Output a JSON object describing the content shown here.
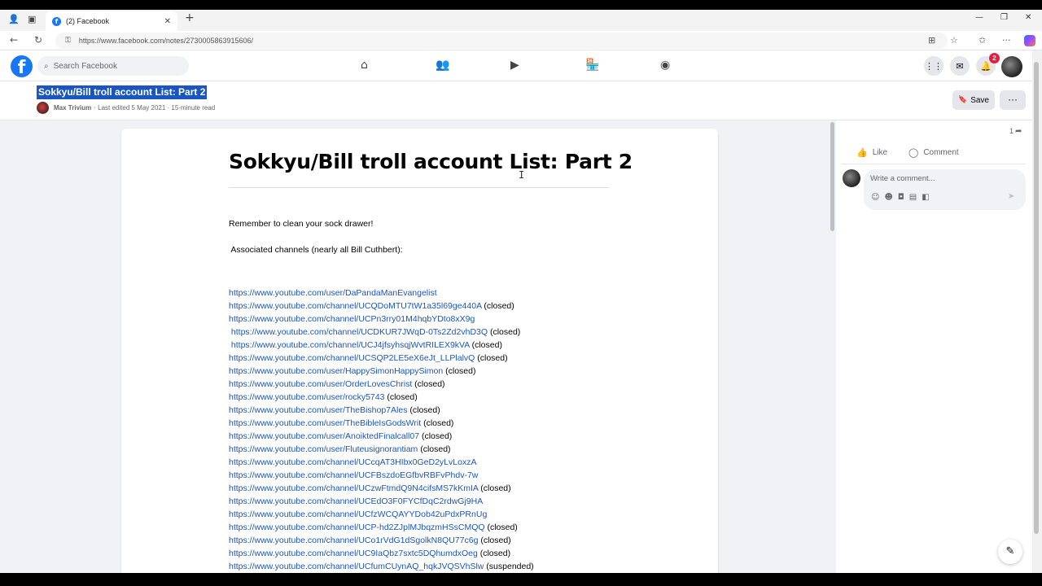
{
  "browser": {
    "tab_title": "(2) Facebook",
    "tab_close": "✕",
    "new_tab": "+",
    "url": "https://www.facebook.com/notes/2730005863915606/"
  },
  "fb": {
    "search_placeholder": "Search Facebook",
    "notification_count": "2"
  },
  "note": {
    "title": "Sokkyu/Bill troll account List: Part 2",
    "author": "Max Trivium",
    "meta": "· Last edited 5 May 2021 · 15-minute read",
    "save_label": "Save",
    "more_label": "···",
    "heading": "Sokkyu/Bill troll account List: Part 2",
    "para1": "Remember to clean your sock drawer!",
    "para2": " Associated channels (nearly all Bill Cuthbert):",
    "links": [
      {
        "url": "https://www.youtube.com/user/DaPandaManEvangelist",
        "status": ""
      },
      {
        "url": "https://www.youtube.com/channel/UCQDoMTU7tW1a35l69ge440A",
        "status": " (closed)"
      },
      {
        "url": "https://www.youtube.com/channel/UCPn3rry01M4hqbYDto8xX9g",
        "status": ""
      },
      {
        "url": " https://www.youtube.com/channel/UCDKUR7JWqD-0Ts2Zd2vhD3Q",
        "status": " (closed)"
      },
      {
        "url": " https://www.youtube.com/channel/UCJ4jfsyhsqjWvtRILEX9kVA",
        "status": " (closed)"
      },
      {
        "url": "https://www.youtube.com/channel/UCSQP2LE5eX6eJt_LLPlalvQ",
        "status": " (closed)"
      },
      {
        "url": "https://www.youtube.com/user/HappySimonHappySimon",
        "status": " (closed)"
      },
      {
        "url": "https://www.youtube.com/user/OrderLovesChrist",
        "status": " (closed)"
      },
      {
        "url": "https://www.youtube.com/user/rocky5743",
        "status": " (closed)"
      },
      {
        "url": "https://www.youtube.com/user/TheBishop7Ales",
        "status": " (closed)"
      },
      {
        "url": "https://www.youtube.com/user/TheBibleIsGodsWrit",
        "status": " (closed)"
      },
      {
        "url": "https://www.youtube.com/user/AnoiktedFinalcall07",
        "status": " (closed)"
      },
      {
        "url": "https://www.youtube.com/user/Fluteusignorantiam",
        "status": " (closed)"
      },
      {
        "url": "https://www.youtube.com/channel/UCcqAT3HIbx0GeD2yLvLoxzA",
        "status": ""
      },
      {
        "url": "https://www.youtube.com/channel/UCFBszdoEGfbvRBFvPhdv-7w",
        "status": ""
      },
      {
        "url": "https://www.youtube.com/channel/UCzwFtmdQ9N4cifsMS7kKmIA",
        "status": " (closed)"
      },
      {
        "url": "https://www.youtube.com/channel/UCEdO3F0FYCfDqC2rdwGj9HA",
        "status": ""
      },
      {
        "url": "https://www.youtube.com/channel/UCfzWCQAYYDob42uPdxPRnUg",
        "status": ""
      },
      {
        "url": "https://www.youtube.com/channel/UCP-hd2ZJplMJbqzmHSsCMQQ",
        "status": " (closed)"
      },
      {
        "url": "https://www.youtube.com/channel/UCo1rVdG1dSgolkN8QU77c6g",
        "status": " (closed)"
      },
      {
        "url": "https://www.youtube.com/channel/UC9IaQbz7sxtc5DQhumdxOeg",
        "status": " (closed)"
      },
      {
        "url": "https://www.youtube.com/channel/UCfumCUynAQ_hqkJVQSVhSlw",
        "status": " (suspended)"
      }
    ]
  },
  "side": {
    "share_count": "1",
    "like_label": "Like",
    "comment_label": "Comment",
    "comment_placeholder": "Write a comment..."
  },
  "colors": {
    "facebook_blue": "#1877f2",
    "link_blue": "#1a55c4",
    "selection": "#1a55c4",
    "badge_red": "#e41e3f"
  }
}
